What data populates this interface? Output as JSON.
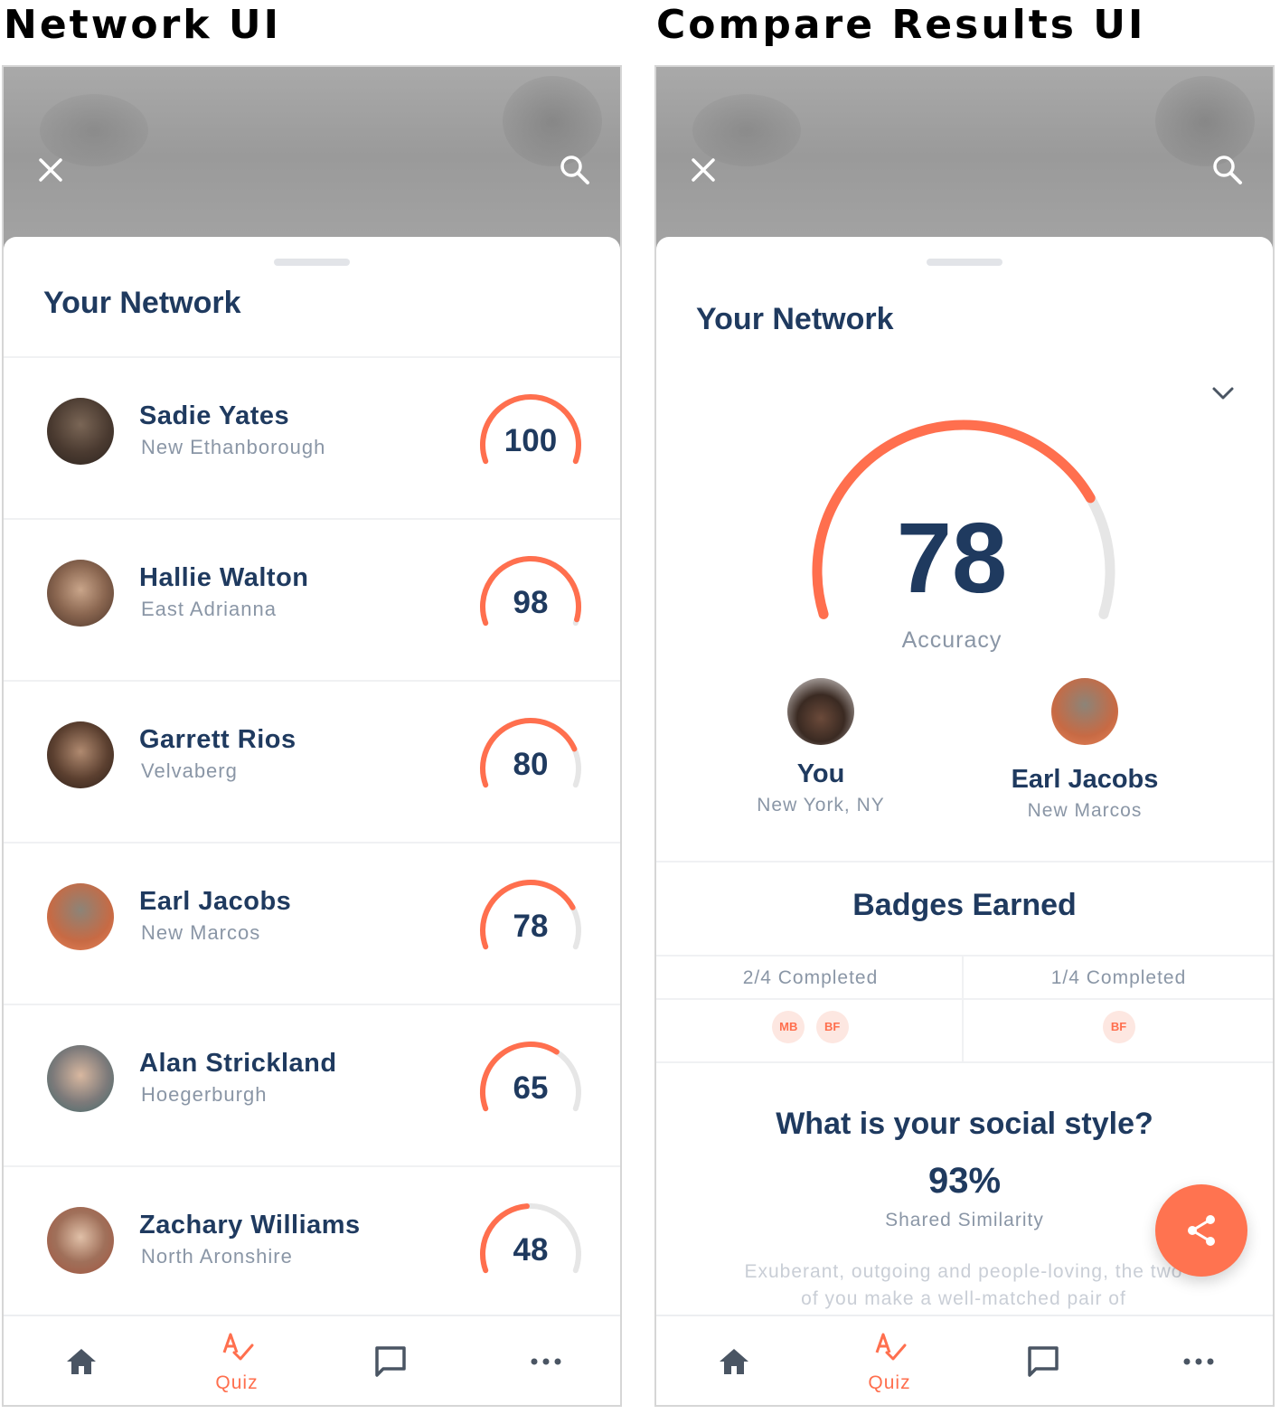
{
  "panels": {
    "left_title": "Network UI",
    "right_title": "Compare Results UI"
  },
  "network": {
    "title": "Your Network",
    "people": [
      {
        "name": "Sadie Yates",
        "city": "New Ethanborough",
        "score": 100
      },
      {
        "name": "Hallie Walton",
        "city": "East Adrianna",
        "score": 98
      },
      {
        "name": "Garrett Rios",
        "city": "Velvaberg",
        "score": 80
      },
      {
        "name": "Earl Jacobs",
        "city": "New Marcos",
        "score": 78
      },
      {
        "name": "Alan Strickland",
        "city": "Hoegerburgh",
        "score": 65
      },
      {
        "name": "Zachary Williams",
        "city": "North Aronshire",
        "score": 48
      }
    ]
  },
  "compare": {
    "title": "Your Network",
    "accuracy": "78",
    "accuracy_fraction": 0.78,
    "accuracy_label": "Accuracy",
    "you": {
      "name": "You",
      "city": "New York, NY"
    },
    "other": {
      "name": "Earl Jacobs",
      "city": "New Marcos"
    },
    "badges": {
      "title": "Badges Earned",
      "left": {
        "label": "2/4 Completed",
        "pills": [
          "MB",
          "BF"
        ]
      },
      "right": {
        "label": "1/4 Completed",
        "pills": [
          "BF"
        ]
      }
    },
    "social": {
      "question": "What is your social style?",
      "percent": "93%",
      "label": "Shared Similarity",
      "description": "Exuberant, outgoing and people-loving, the two of you make a well-matched pair of"
    }
  },
  "nav": {
    "quiz_label": "Quiz"
  },
  "colors": {
    "accent": "#ff6f4e",
    "navy": "#1f3a5f",
    "muted": "#8a96a6",
    "track": "#e6e6e6"
  },
  "icons": [
    "close-icon",
    "search-icon",
    "home-icon",
    "quiz-icon",
    "chat-icon",
    "more-icon",
    "share-icon",
    "chevron-down-icon"
  ]
}
